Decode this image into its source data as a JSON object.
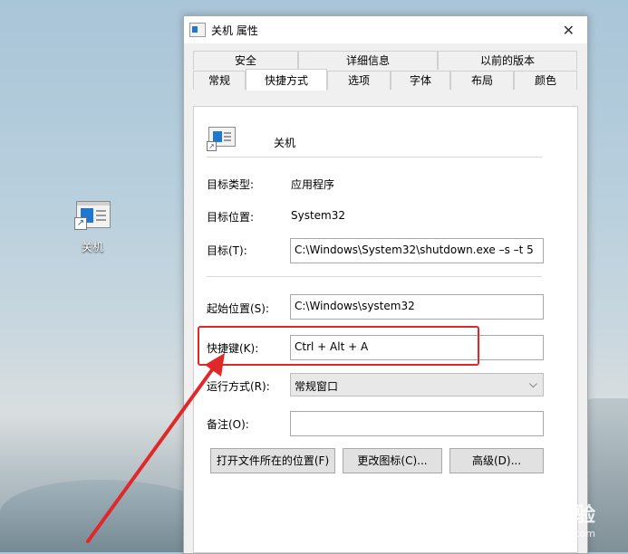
{
  "desktop": {
    "icon_label": "关机"
  },
  "dialog": {
    "title": "关机 属性",
    "close_glyph": "✕",
    "tabs_top": [
      "安全",
      "详细信息",
      "以前的版本"
    ],
    "tabs_bottom": [
      "常规",
      "快捷方式",
      "选项",
      "字体",
      "布局",
      "颜色"
    ],
    "active_tab": "快捷方式",
    "shortcut_name": "关机",
    "target_type_label": "目标类型:",
    "target_type_value": "应用程序",
    "target_location_label": "目标位置:",
    "target_location_value": "System32",
    "target_label": "目标(T):",
    "target_value": "C:\\Windows\\System32\\shutdown.exe –s –t 5",
    "start_in_label": "起始位置(S):",
    "start_in_value": "C:\\Windows\\system32",
    "hotkey_label": "快捷键(K):",
    "hotkey_value": "Ctrl + Alt + A",
    "run_label": "运行方式(R):",
    "run_value": "常规窗口",
    "comment_label": "备注(O):",
    "comment_value": "",
    "buttons": {
      "open_location": "打开文件所在的位置(F)",
      "change_icon": "更改图标(C)...",
      "advanced": "高级(D)..."
    }
  },
  "annotation": {
    "box_color": "#e02828"
  },
  "watermark": {
    "line1": "Baidu 经验",
    "line2": "jingyan.baidu.com"
  }
}
